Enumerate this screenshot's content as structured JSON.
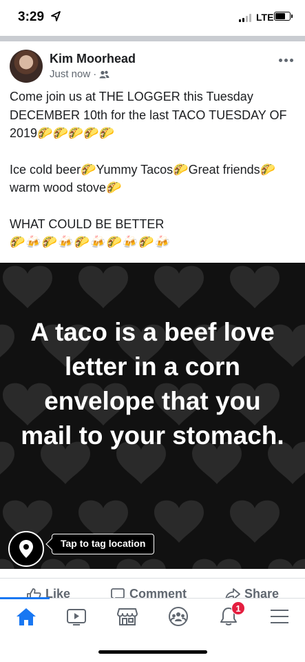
{
  "status_bar": {
    "time": "3:29",
    "network": "LTE",
    "signal_bars": 4,
    "signal_bars_filled": 2,
    "battery_level": 0.75
  },
  "post": {
    "author": "Kim Moorhead",
    "timestamp": "Just now",
    "separator": "·",
    "audience_icon": "friends-icon",
    "paragraphs": [
      "Come join us at THE LOGGER this Tuesday DECEMBER 10th for the last TACO TUESDAY OF 2019🌮🌮🌮🌮🌮",
      "Ice cold beer🌮Yummy Tacos🌮Great friends🌮warm wood stove🌮",
      "WHAT COULD BE BETTER"
    ],
    "emoji_line": "🌮🍻🌮🍻🌮🍻🌮🍻🌮🍻",
    "image": {
      "quote": "A taco is a beef love letter in a corn envelope that you mail to your stomach.",
      "tag_location_label": "Tap to tag location",
      "background": "#111111"
    }
  },
  "actions": {
    "like": "Like",
    "comment": "Comment",
    "share": "Share"
  },
  "tabbar": {
    "items": [
      "home-icon",
      "video-icon",
      "marketplace-icon",
      "groups-icon",
      "notifications-icon",
      "menu-icon"
    ],
    "notification_count": "1",
    "active_color": "#1877f2",
    "inactive_color": "#606770"
  }
}
